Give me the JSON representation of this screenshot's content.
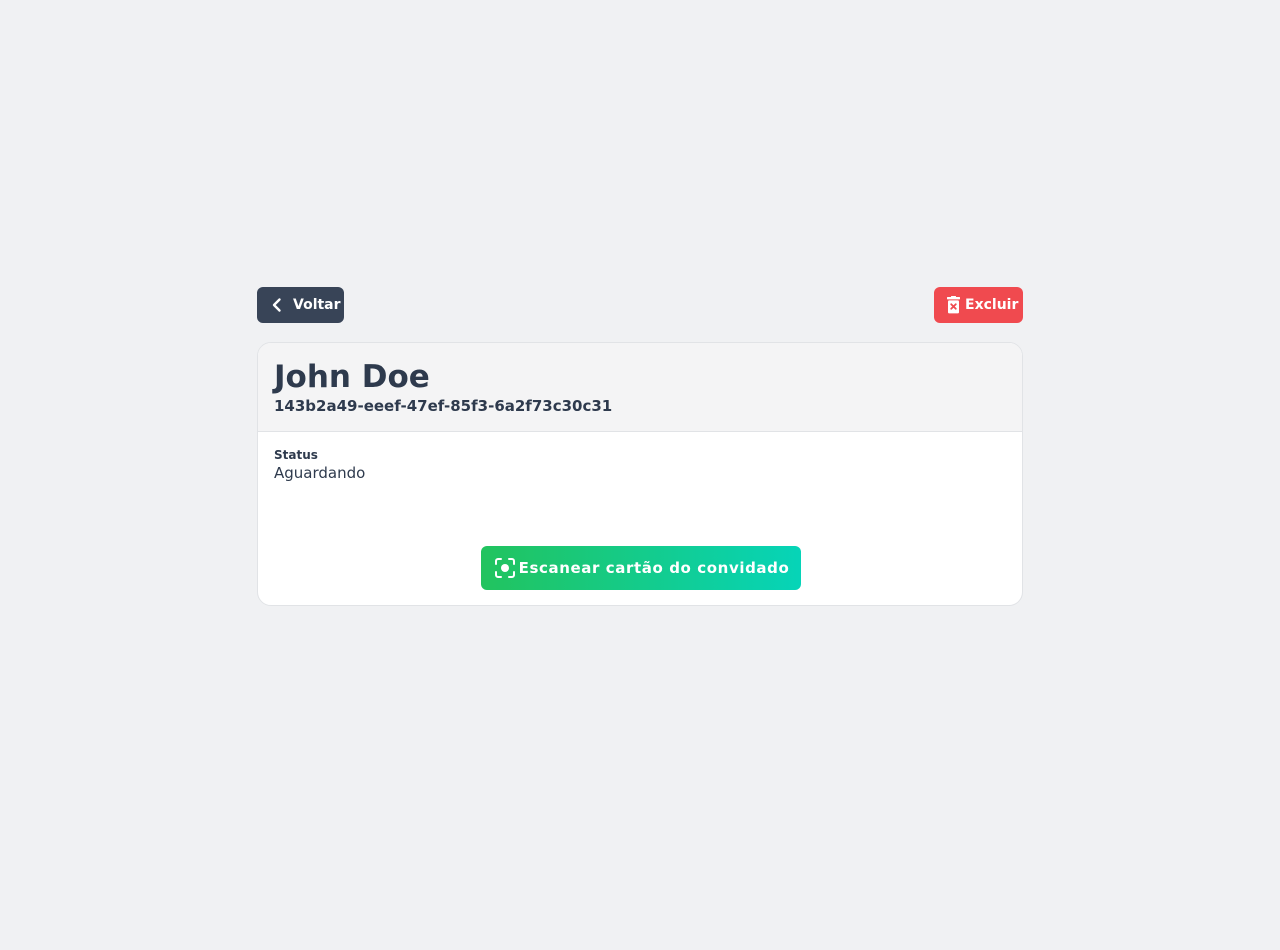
{
  "toolbar": {
    "back_label": "Voltar",
    "delete_label": "Excluir"
  },
  "guest": {
    "name": "John Doe",
    "id": "143b2a49-eeef-47ef-85f3-6a2f73c30c31",
    "status_label": "Status",
    "status_value": "Aguardando"
  },
  "actions": {
    "scan_label": "Escanear cartão do convidado"
  },
  "icons": {
    "back": "chevron-left-icon",
    "delete": "trash-x-icon",
    "scan": "scan-focus-icon"
  },
  "colors": {
    "back_button": "#384457",
    "delete_button": "#f04a4f",
    "scan_gradient_start": "#22c35e",
    "scan_gradient_end": "#06d4b8",
    "text": "#2e3a4d",
    "background": "#f0f1f3"
  }
}
